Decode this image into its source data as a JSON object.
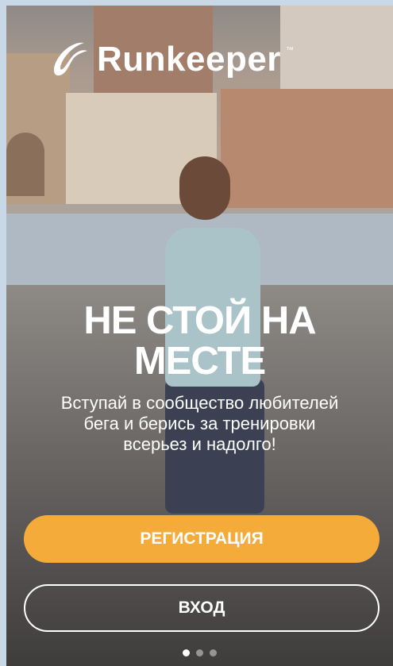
{
  "brand": {
    "name": "Runkeeper",
    "tm": "™"
  },
  "hero": {
    "headline_line1": "НЕ СТОЙ НА",
    "headline_line2": "МЕСТЕ",
    "subtitle": "Вступай в сообщество любителей бега и берись за тренировки всерьез и надолго!"
  },
  "actions": {
    "register_label": "РЕГИСТРАЦИЯ",
    "login_label": "ВХОД"
  },
  "pager": {
    "count": 3,
    "active_index": 0
  },
  "colors": {
    "primary_button": "#f4ab3a",
    "text": "#ffffff"
  },
  "icons": {
    "logo": "runkeeper-logo-icon"
  }
}
